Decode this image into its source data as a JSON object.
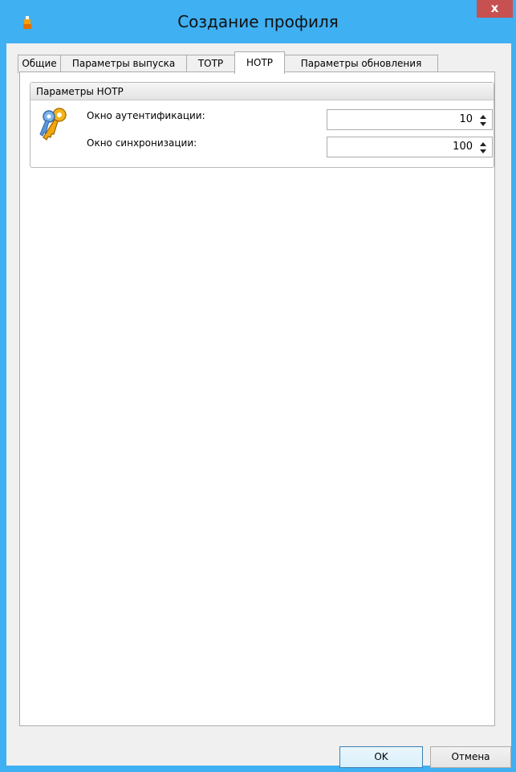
{
  "window": {
    "title": "Создание профиля",
    "close_label": "x"
  },
  "tabs": [
    {
      "label": "Общие"
    },
    {
      "label": "Параметры выпуска"
    },
    {
      "label": "TOTP"
    },
    {
      "label": "HOTP"
    },
    {
      "label": "Параметры обновления"
    }
  ],
  "active_tab": "HOTP",
  "group": {
    "title": "Параметры HOTP",
    "icon": "keys-icon",
    "fields": [
      {
        "label": "Окно аутентификации:",
        "value": "10"
      },
      {
        "label": "Окно синхронизации:",
        "value": "100"
      }
    ]
  },
  "buttons": {
    "ok": "OK",
    "cancel": "Отмена"
  },
  "colors": {
    "titlebar": "#3fb0f2",
    "close": "#c75050",
    "client": "#f0f0f0"
  }
}
